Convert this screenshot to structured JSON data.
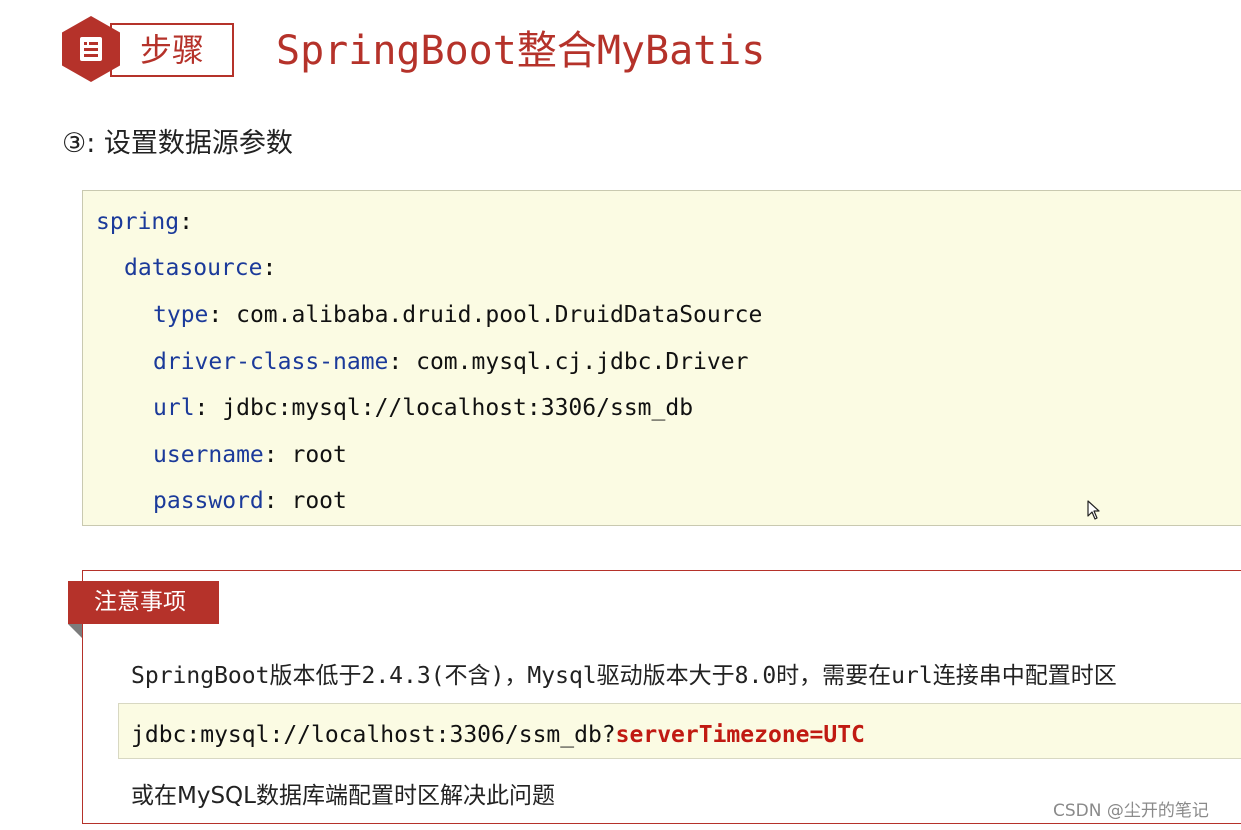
{
  "header": {
    "icon": "document-icon",
    "step_label": "步骤",
    "title": "SpringBoot整合MyBatis"
  },
  "subtitle": "③: 设置数据源参数",
  "code_block": {
    "lines": [
      {
        "key": "spring",
        "sep": ":",
        "value": ""
      },
      {
        "key": "datasource",
        "sep": ":",
        "value": ""
      },
      {
        "key": "type",
        "sep": ":",
        "value": " com.alibaba.druid.pool.DruidDataSource"
      },
      {
        "key": "driver-class-name",
        "sep": ":",
        "value": " com.mysql.cj.jdbc.Driver"
      },
      {
        "key": "url",
        "sep": ":",
        "value": " jdbc:mysql://localhost:3306/ssm_db"
      },
      {
        "key": "username",
        "sep": ":",
        "value": " root"
      },
      {
        "key": "password",
        "sep": ":",
        "value": " root"
      }
    ]
  },
  "notice": {
    "tab_label": "注意事项",
    "line1": "SpringBoot版本低于2.4.3(不含)，Mysql驱动版本大于8.0时，需要在url连接串中配置时区",
    "code_plain": "jdbc:mysql://localhost:3306/ssm_db?",
    "code_highlight": "serverTimezone=UTC",
    "line3": "或在MySQL数据库端配置时区解决此问题"
  },
  "watermark": "CSDN @尘开的笔记",
  "colors": {
    "accent": "#b5322a",
    "code_bg": "#fbfbe3",
    "key_color": "#1b3a9a",
    "highlight": "#c01a12"
  }
}
